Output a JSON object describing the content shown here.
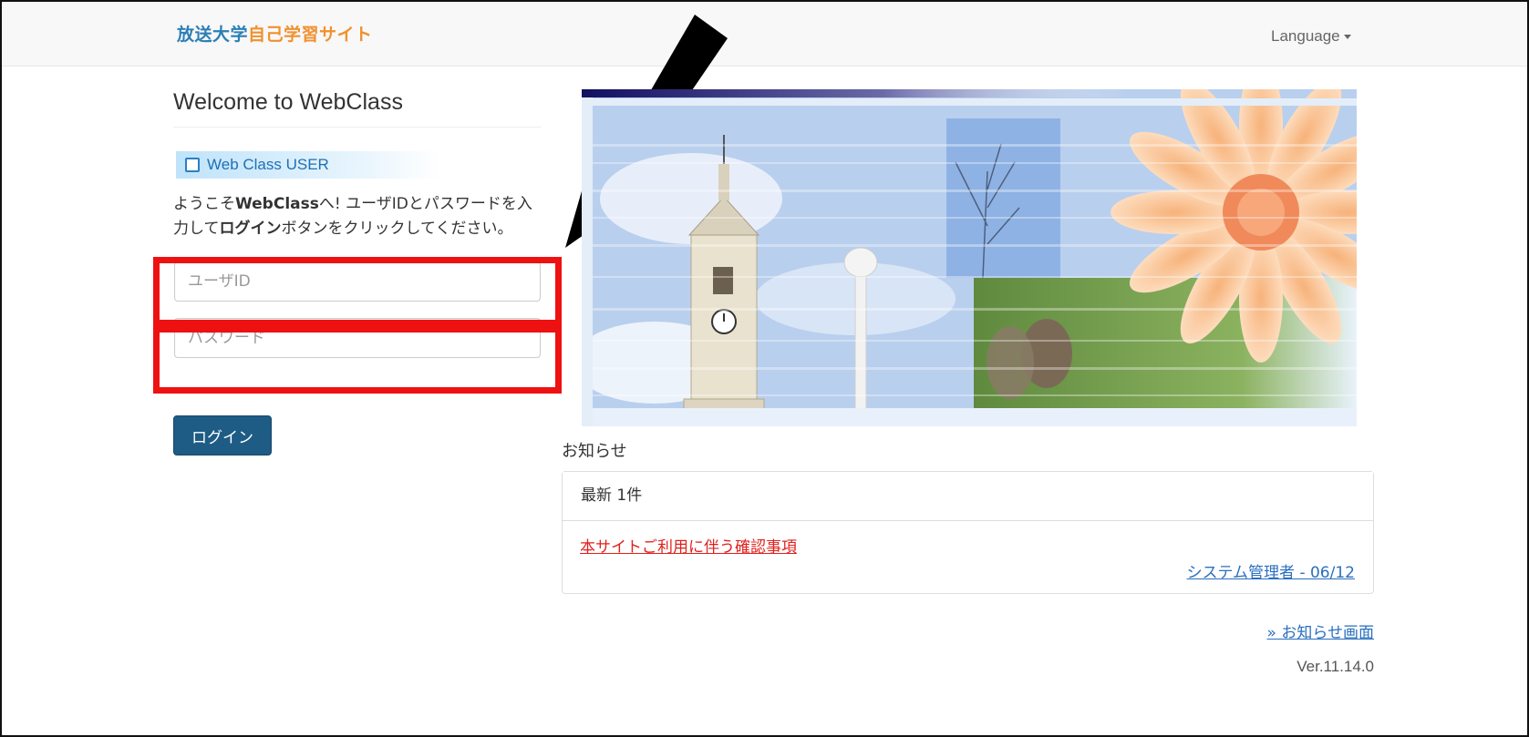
{
  "brand": {
    "part1": "放送大学",
    "part2": "自己学習サイト"
  },
  "navbar": {
    "language_label": "Language"
  },
  "login": {
    "heading": "Welcome to WebClass",
    "badge_label": "Web Class USER",
    "intro_part1": "ようこそ",
    "intro_bold1": "WebClass",
    "intro_part2": "へ! ユーザIDとパスワードを入力して",
    "intro_bold2": "ログイン",
    "intro_part3": "ボタンをクリックしてください。",
    "userid_placeholder": "ユーザID",
    "userid_value": "",
    "password_placeholder": "パスワード",
    "password_value": "",
    "login_button": "ログイン"
  },
  "notices": {
    "title": "お知らせ",
    "count_label": "最新 1件",
    "items": [
      {
        "title": "本サイトご利用に伴う確認事項",
        "author_date": "システム管理者 - 06/12"
      }
    ],
    "more_link": "» お知らせ画面",
    "version": "Ver.11.14.0"
  },
  "colors": {
    "brand_blue": "#2a7fb5",
    "brand_orange": "#f0912e",
    "login_button_bg": "#1e5b85",
    "highlight_red": "#ee1111",
    "notice_link_red": "#e0201c",
    "link_blue": "#2a6fbf"
  },
  "icons": {
    "badge_icon": "checkbox-icon",
    "arrow_annotation": "arrow-down-left-icon",
    "language_caret": "caret-down-icon"
  }
}
